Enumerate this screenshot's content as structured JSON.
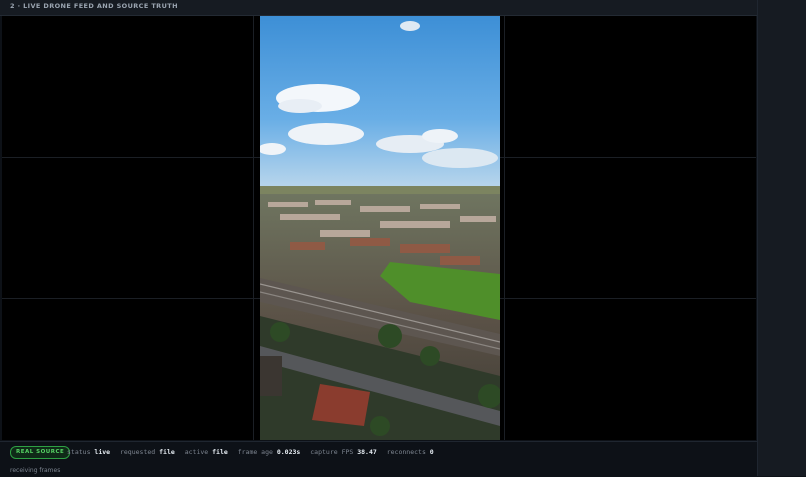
{
  "header": {
    "title": "2 · LIVE DRONE FEED AND SOURCE TRUTH"
  },
  "status": {
    "badge": "REAL SOURCE",
    "items": [
      {
        "key": "status",
        "value": "live"
      },
      {
        "key": "requested",
        "value": "file"
      },
      {
        "key": "active",
        "value": "file"
      },
      {
        "key": "frame age",
        "value": "0.023s"
      },
      {
        "key": "capture FPS",
        "value": "38.47"
      },
      {
        "key": "reconnects",
        "value": "0"
      }
    ],
    "message": "receiving frames"
  },
  "colors": {
    "background": "#0d1117",
    "badge_accent": "#56d364",
    "sky": "#4a9ad8",
    "field": "#4f8f2a"
  }
}
